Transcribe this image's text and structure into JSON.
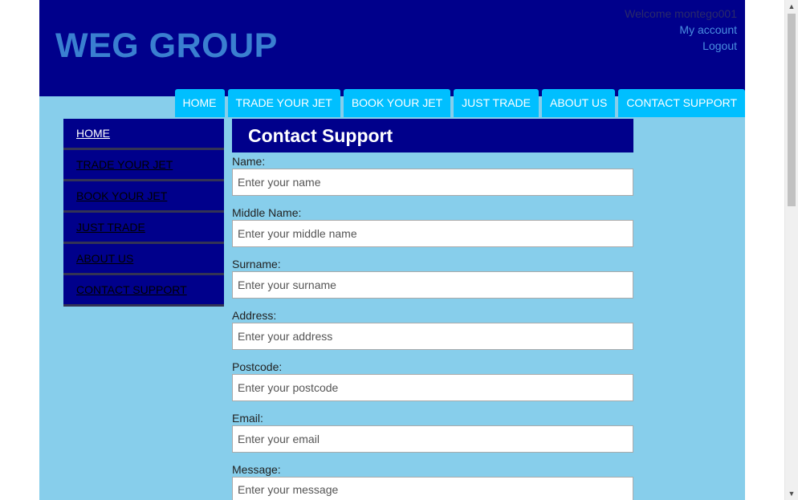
{
  "header": {
    "logo": "WEG GROUP",
    "welcome": "Welcome montego001",
    "my_account": "My account",
    "logout": "Logout"
  },
  "topnav": [
    {
      "label": "HOME"
    },
    {
      "label": "TRADE YOUR JET"
    },
    {
      "label": "BOOK YOUR JET"
    },
    {
      "label": "JUST TRADE"
    },
    {
      "label": "ABOUT US"
    },
    {
      "label": "CONTACT SUPPORT"
    }
  ],
  "sidenav": [
    {
      "label": "HOME",
      "active": true
    },
    {
      "label": "TRADE YOUR JET"
    },
    {
      "label": "BOOK YOUR JET"
    },
    {
      "label": "JUST TRADE"
    },
    {
      "label": "ABOUT US"
    },
    {
      "label": "CONTACT SUPPORT"
    }
  ],
  "form": {
    "title": "Contact Support",
    "fields": [
      {
        "label": "Name:",
        "placeholder": "Enter your name"
      },
      {
        "label": "Middle Name:",
        "placeholder": "Enter your middle name"
      },
      {
        "label": "Surname:",
        "placeholder": "Enter your surname"
      },
      {
        "label": "Address:",
        "placeholder": "Enter your address"
      },
      {
        "label": "Postcode:",
        "placeholder": "Enter your postcode"
      },
      {
        "label": "Email:",
        "placeholder": "Enter your email"
      },
      {
        "label": "Message:",
        "placeholder": "Enter your message"
      }
    ]
  },
  "colors": {
    "header_bg": "#00008b",
    "page_bg": "#87ceeb",
    "nav_tab_bg": "#00bfff",
    "logo": "#3a7fd0"
  },
  "icons": {
    "scroll_up": "▲",
    "scroll_down": "▼"
  }
}
